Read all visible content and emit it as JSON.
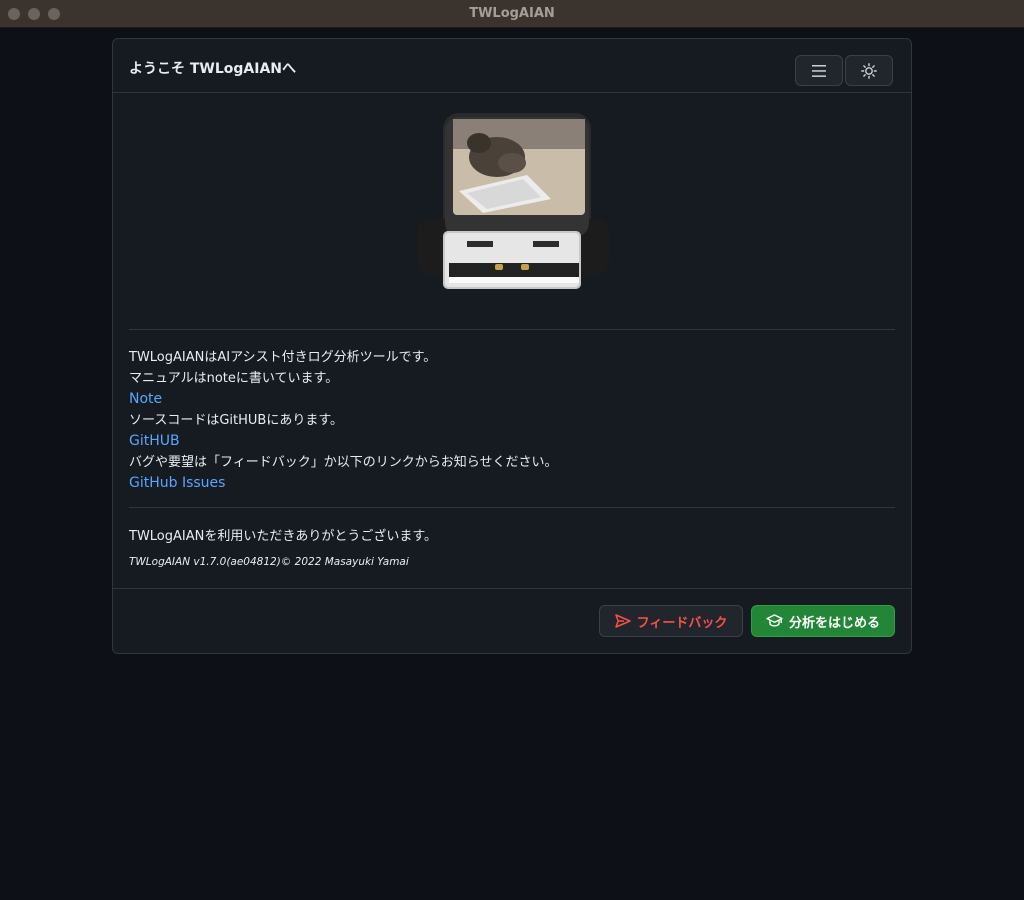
{
  "window": {
    "title": "TWLogAIAN"
  },
  "header": {
    "title": "ようこそ TWLogAIANへ",
    "menu_icon": "hamburger-menu-icon",
    "theme_icon": "sun-icon"
  },
  "hero": {
    "image": "usb-drive-with-cat-photo"
  },
  "intro": {
    "line1": "TWLogAIANはAIアシスト付きログ分析ツールです。",
    "line2": "マニュアルはnoteに書いています。",
    "note_link": "Note",
    "line3": "ソースコードはGitHUBにあります。",
    "github_link": "GitHUB",
    "line4": "バグや要望は「フィードバック」か以下のリンクからお知らせください。",
    "issues_link": "GitHub Issues"
  },
  "thanks": "TWLogAIANを利用いただきありがとうございます。",
  "version": "TWLogAIAN v1.7.0(ae04812)© 2022 Masayuki Yamai",
  "footer": {
    "feedback_label": "フィードバック",
    "feedback_icon": "send-icon",
    "start_label": "分析をはじめる",
    "start_icon": "graduation-cap-icon"
  },
  "colors": {
    "background": "#0d1117",
    "panel": "#161b22",
    "link": "#58a6ff",
    "danger": "#f85149",
    "primary": "#238636"
  }
}
